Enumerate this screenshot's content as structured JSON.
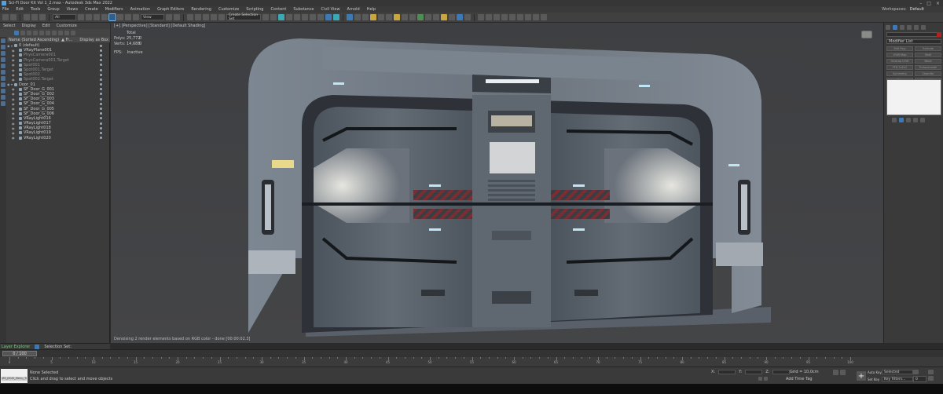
{
  "app": {
    "title": "Sci-Fi Door Kit Vol 1_2.max - Autodesk 3ds Max 2022",
    "accent": "#3d79b5"
  },
  "menubar": {
    "items": [
      "File",
      "Edit",
      "Tools",
      "Group",
      "Views",
      "Create",
      "Modifiers",
      "Animation",
      "Graph Editors",
      "Rendering",
      "Customize",
      "Scripting",
      "Content",
      "Substance",
      "Civil View",
      "Arnold",
      "Help"
    ],
    "workspaces_label": "Workspaces:",
    "workspaces_value": "Default"
  },
  "toolbar": {
    "filter_value": "All",
    "view_value": "View",
    "selection_set_placeholder": "Create Selection Set"
  },
  "scene_explorer": {
    "menu": [
      "Select",
      "Display",
      "Edit",
      "Customize"
    ],
    "columns": {
      "name": "Name (Sorted Ascending)",
      "frozen": "▲ Fr...",
      "display": "Display as Box"
    },
    "rows": [
      {
        "label": "0 (default)",
        "indent": 0,
        "icon": "layer-icon",
        "dim": false
      },
      {
        "label": "VRayPlane001",
        "indent": 1,
        "icon": "object-icon",
        "dim": false
      },
      {
        "label": "PhysCamera001",
        "indent": 1,
        "icon": "camera-icon",
        "dim": true
      },
      {
        "label": "PhysCamera001.Target",
        "indent": 1,
        "icon": "camera-icon",
        "dim": true
      },
      {
        "label": "Spot001",
        "indent": 1,
        "icon": "light-icon",
        "dim": true
      },
      {
        "label": "Spot001.Target",
        "indent": 1,
        "icon": "light-icon",
        "dim": true
      },
      {
        "label": "Spot002",
        "indent": 1,
        "icon": "light-icon",
        "dim": true
      },
      {
        "label": "Spot002.Target",
        "indent": 1,
        "icon": "light-icon",
        "dim": true
      },
      {
        "label": "Door_01",
        "indent": 0,
        "icon": "layer-icon",
        "dim": false
      },
      {
        "label": "SF_Door_G_001",
        "indent": 1,
        "icon": "object-icon",
        "dim": false
      },
      {
        "label": "SF_Door_G_002",
        "indent": 1,
        "icon": "object-icon",
        "dim": false
      },
      {
        "label": "SF_Door_G_003",
        "indent": 1,
        "icon": "object-icon",
        "dim": false
      },
      {
        "label": "SF_Door_G_004",
        "indent": 1,
        "icon": "object-icon",
        "dim": false
      },
      {
        "label": "SF_Door_G_005",
        "indent": 1,
        "icon": "object-icon",
        "dim": false
      },
      {
        "label": "SF_Door_G_006",
        "indent": 1,
        "icon": "object-icon",
        "dim": false
      },
      {
        "label": "VRayLight016",
        "indent": 1,
        "icon": "light-icon",
        "dim": false
      },
      {
        "label": "VRayLight017",
        "indent": 1,
        "icon": "light-icon",
        "dim": false
      },
      {
        "label": "VRayLight018",
        "indent": 1,
        "icon": "light-icon",
        "dim": false
      },
      {
        "label": "VRayLight019",
        "indent": 1,
        "icon": "light-icon",
        "dim": false
      },
      {
        "label": "VRayLight020",
        "indent": 1,
        "icon": "light-icon",
        "dim": false
      }
    ],
    "layer_explorer_label": "Layer Explorer",
    "selection_set_label": "Selection Set:"
  },
  "viewport": {
    "label": "[+] [Perspective] [Standard] [Default Shading]",
    "stats_header": "Total",
    "stats": [
      {
        "label": "Polys:",
        "value": "25,772",
        "sel": "0"
      },
      {
        "label": "Verts:",
        "value": "14,688",
        "sel": "0"
      }
    ],
    "fps_label": "FPS:",
    "fps_value": "Inactive",
    "status_message": "Denoising 2 render elements based on RGB color - done [00:00:02.3]"
  },
  "command_panel": {
    "modifier_list": "Modifier List",
    "buttons": [
      "Edit Poly",
      "Extrude",
      "UVW Map",
      "Shell",
      "Unwrap UVW",
      "Bend",
      "FFD 2x2x2",
      "Turbosmooth",
      "Symmetry",
      "Chamfer",
      "Slice",
      "Cap Holes"
    ]
  },
  "time_slider": {
    "value": "0 / 100"
  },
  "trackbar": {
    "ticks": [
      0,
      5,
      10,
      15,
      20,
      25,
      30,
      35,
      40,
      45,
      50,
      55,
      60,
      65,
      70,
      75,
      80,
      85,
      90,
      95,
      100
    ]
  },
  "status_bar": {
    "script_text": "JZS_DGIS_Menu_TAR",
    "selection_status": "None Selected",
    "prompt": "Click and drag to select and move objects",
    "coord_x": "X:",
    "coord_y": "Y:",
    "coord_z": "Z:",
    "grid": "Grid = 10,0cm",
    "add_time_tag": "Add Time Tag",
    "auto_key": "Auto Key",
    "auto_key_value": "Selected",
    "set_key": "Set Key",
    "key_filters": "Key Filters...",
    "frame_value": "0"
  },
  "door": {
    "frame_color": "#6d7681",
    "panel_color": "#5b636d",
    "hazard_color": "#7a2e33",
    "light_color": "#bfe6f5"
  }
}
